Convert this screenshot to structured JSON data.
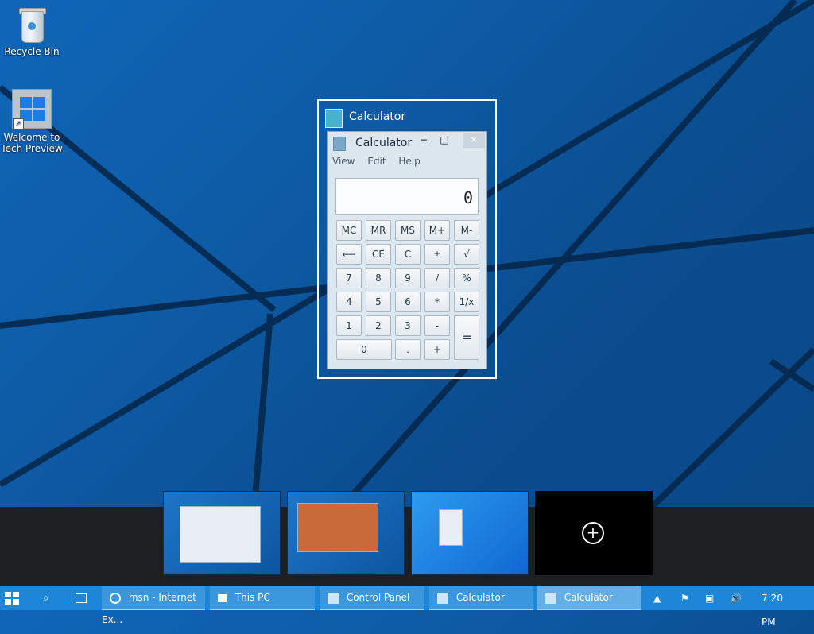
{
  "desktop": {
    "icons": [
      {
        "name": "recycle-bin",
        "label": "Recycle Bin"
      },
      {
        "name": "welcome-tech-preview",
        "label_line1": "Welcome to",
        "label_line2": "Tech Preview"
      }
    ]
  },
  "switcher": {
    "title": "Calculator"
  },
  "calculator": {
    "window_title": "Calculator",
    "menu": [
      "View",
      "Edit",
      "Help"
    ],
    "display": "0",
    "keys": {
      "mc": "MC",
      "mr": "MR",
      "ms": "MS",
      "mplus": "M+",
      "mminus": "M-",
      "back": "⟵",
      "ce": "CE",
      "c": "C",
      "plusminus": "±",
      "sqrt": "√",
      "k7": "7",
      "k8": "8",
      "k9": "9",
      "div": "/",
      "pct": "%",
      "k4": "4",
      "k5": "5",
      "k6": "6",
      "mul": "*",
      "recip": "1/x",
      "k1": "1",
      "k2": "2",
      "k3": "3",
      "sub": "-",
      "eq": "=",
      "k0": "0",
      "dot": ".",
      "add": "+"
    }
  },
  "taskbar": {
    "apps": [
      {
        "name": "msn",
        "label": "msn - Internet Ex..."
      },
      {
        "name": "this-pc",
        "label": "This PC"
      },
      {
        "name": "control-panel",
        "label": "Control Panel"
      },
      {
        "name": "calculator",
        "label": "Calculator"
      },
      {
        "name": "calculator-active",
        "label": "Calculator"
      }
    ],
    "clock": "7:20 PM"
  },
  "virtual_desktops": {
    "plus_label": "+"
  },
  "colors": {
    "taskbar": "#1e86d6",
    "desktop": "#0f66b8",
    "strip": "#1e1f21"
  }
}
